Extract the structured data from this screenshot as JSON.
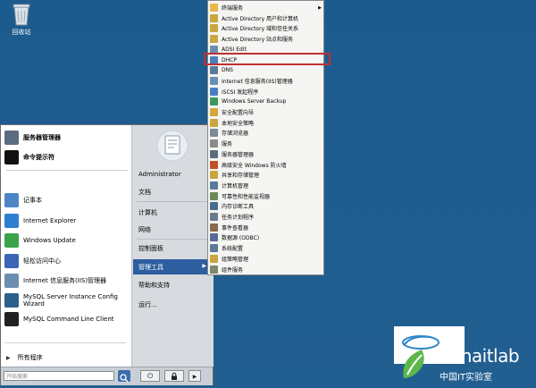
{
  "desktop": {
    "recycle_label": "回收站"
  },
  "start_menu": {
    "pinned": [
      {
        "label": "服务器管理器",
        "bold": true,
        "icon": "server-manager-icon",
        "color": "#5b6b80"
      },
      {
        "label": "命令提示符",
        "bold": true,
        "icon": "command-prompt-icon",
        "color": "#111111"
      },
      {
        "label": "记事本",
        "bold": false,
        "icon": "notepad-icon",
        "color": "#4d86c7"
      },
      {
        "label": "Internet Explorer",
        "bold": false,
        "icon": "internet-explorer-icon",
        "color": "#2f7fd0"
      },
      {
        "label": "Windows Update",
        "bold": false,
        "icon": "windows-update-icon",
        "color": "#3aa34a"
      },
      {
        "label": "轻松访问中心",
        "bold": false,
        "icon": "ease-of-access-icon",
        "color": "#3a66b5"
      },
      {
        "label": "Internet 信息服务(IIS)管理器",
        "bold": false,
        "icon": "iis-manager-icon",
        "color": "#6b8fb0"
      },
      {
        "label": "MySQL Server Instance Config Wizard",
        "bold": false,
        "icon": "mysql-wizard-icon",
        "color": "#2d5f8c"
      },
      {
        "label": "MySQL Command Line Client",
        "bold": false,
        "icon": "mysql-cli-icon",
        "color": "#222222"
      }
    ],
    "all_programs": "所有程序",
    "search_placeholder": "开始搜索",
    "right": {
      "user": "Administrator",
      "documents": "文档",
      "computer": "计算机",
      "network": "网络",
      "control_panel": "控制面板",
      "admin_tools": "管理工具",
      "help": "帮助和支持",
      "run": "运行..."
    }
  },
  "admin_menu": {
    "items": [
      {
        "label": "终端服务",
        "icon": "folder-icon",
        "color": "#e8b84a",
        "arrow": true
      },
      {
        "label": "Active Directory 用户和计算机",
        "icon": "ad-users-icon",
        "color": "#c9a640"
      },
      {
        "label": "Active Directory 域和信任关系",
        "icon": "ad-domains-icon",
        "color": "#c9a640"
      },
      {
        "label": "Active Directory 站点和服务",
        "icon": "ad-sites-icon",
        "color": "#c9a640"
      },
      {
        "label": "ADSI Edit",
        "icon": "adsi-edit-icon",
        "color": "#6b8fb0"
      },
      {
        "label": "DHCP",
        "icon": "dhcp-icon",
        "color": "#4a7fbf"
      },
      {
        "label": "DNS",
        "icon": "dns-icon",
        "color": "#5a7a9a"
      },
      {
        "label": "Internet 信息服务(IIS)管理器",
        "icon": "iis-icon",
        "color": "#6b8fb0"
      },
      {
        "label": "iSCSI 发起程序",
        "icon": "iscsi-icon",
        "color": "#4a7fbf"
      },
      {
        "label": "Windows Server Backup",
        "icon": "backup-icon",
        "color": "#3a9a5a"
      },
      {
        "label": "安全配置向导",
        "icon": "security-wizard-icon",
        "color": "#d4a83a"
      },
      {
        "label": "本地安全策略",
        "icon": "local-policy-icon",
        "color": "#c9a640"
      },
      {
        "label": "存储浏览器",
        "icon": "storage-icon",
        "color": "#7a8a9a"
      },
      {
        "label": "服务",
        "icon": "services-icon",
        "color": "#8a8a8a"
      },
      {
        "label": "服务器管理器",
        "icon": "server-manager-icon",
        "color": "#5b6b80"
      },
      {
        "label": "高级安全 Windows 防火墙",
        "icon": "firewall-icon",
        "color": "#c0502a"
      },
      {
        "label": "共享和存储管理",
        "icon": "share-storage-icon",
        "color": "#c9a640"
      },
      {
        "label": "计算机管理",
        "icon": "computer-management-icon",
        "color": "#5a7a9a"
      },
      {
        "label": "可靠性和性能监视器",
        "icon": "performance-icon",
        "color": "#6a8a5a"
      },
      {
        "label": "内存诊断工具",
        "icon": "memory-diagnostic-icon",
        "color": "#4a6a8a"
      },
      {
        "label": "任务计划程序",
        "icon": "task-scheduler-icon",
        "color": "#6a7a8a"
      },
      {
        "label": "事件查看器",
        "icon": "event-viewer-icon",
        "color": "#8a6a4a"
      },
      {
        "label": "数据源 (ODBC)",
        "icon": "odbc-icon",
        "color": "#5a6a9a"
      },
      {
        "label": "系统配置",
        "icon": "system-config-icon",
        "color": "#5a7a9a"
      },
      {
        "label": "组策略管理",
        "icon": "group-policy-icon",
        "color": "#c9a640"
      },
      {
        "label": "组件服务",
        "icon": "component-services-icon",
        "color": "#7a8a6a"
      }
    ]
  },
  "watermark": {
    "brand": "chinaitlab",
    "sub": "中国IT实验室"
  }
}
